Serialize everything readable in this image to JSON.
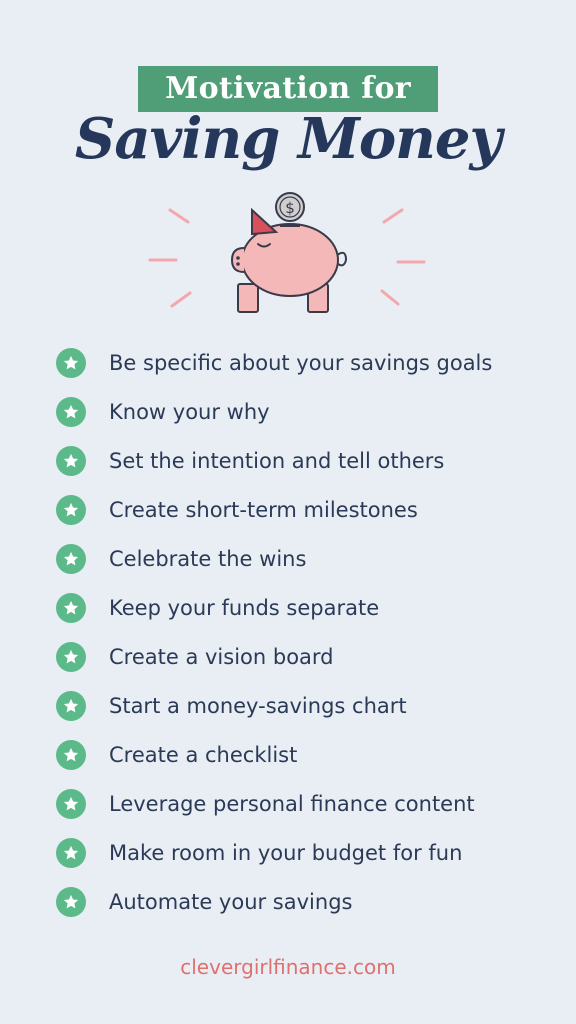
{
  "header": {
    "banner": "Motivation for",
    "title": "Saving Money"
  },
  "illustration": {
    "icon": "piggy-bank-icon",
    "coin_symbol": "$"
  },
  "list": {
    "icon": "star-icon",
    "items": [
      {
        "label": "Be specific about your savings goals"
      },
      {
        "label": "Know your why"
      },
      {
        "label": "Set the intention and tell others"
      },
      {
        "label": "Create short-term milestones"
      },
      {
        "label": "Celebrate the wins"
      },
      {
        "label": "Keep your funds separate"
      },
      {
        "label": "Create a vision board"
      },
      {
        "label": "Start a money-savings chart"
      },
      {
        "label": "Create a checklist"
      },
      {
        "label": "Leverage personal finance content"
      },
      {
        "label": "Make room in your budget for fun"
      },
      {
        "label": "Automate your savings"
      }
    ]
  },
  "footer": {
    "site": "clevergirlfinance.com"
  },
  "colors": {
    "background": "#e8eef4",
    "banner": "#4f9e77",
    "title": "#25375a",
    "star_badge": "#5cba8a",
    "text": "#2b3a56",
    "footer": "#e0706e",
    "pig": "#f4b8b8",
    "pig_outline": "#3a3a4a",
    "slot": "#d9505a",
    "coin": "#c9c9c9"
  }
}
